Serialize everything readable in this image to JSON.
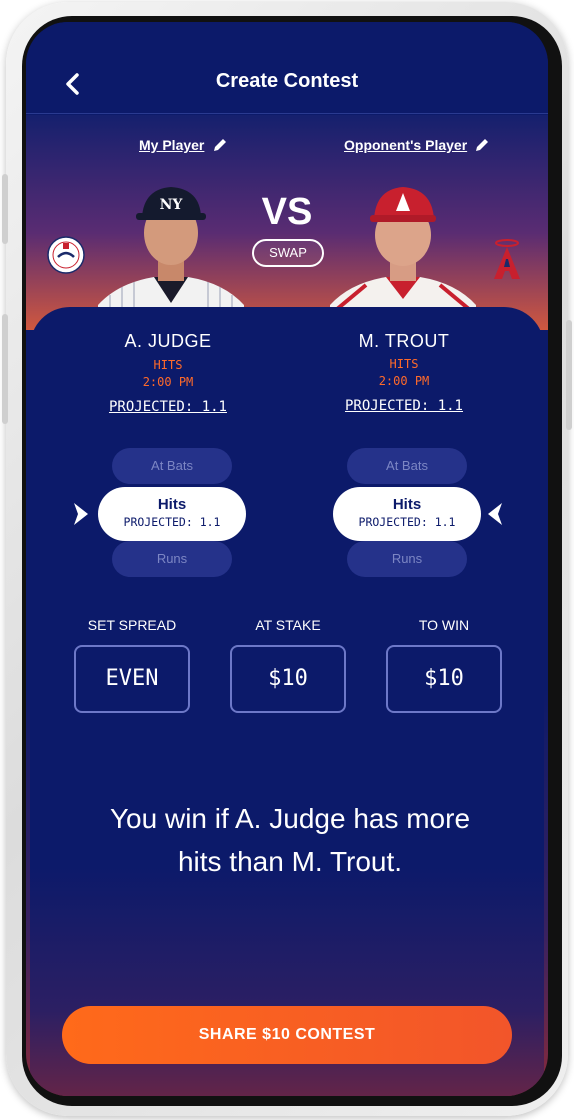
{
  "header": {
    "title": "Create Contest",
    "back_icon": "chevron-left-icon"
  },
  "hero": {
    "my_player_label": "My Player",
    "opponent_player_label": "Opponent's Player",
    "vs_label": "VS",
    "swap_label": "SWAP",
    "left_team_logo": "yankees-logo",
    "right_team_logo": "angels-logo"
  },
  "players": [
    {
      "name": "A. JUDGE",
      "stat": "HITS",
      "time": "2:00 PM",
      "projected": "PROJECTED: 1.1",
      "options": {
        "above": "At Bats",
        "selected": "Hits",
        "selected_projected": "PROJECTED: 1.1",
        "below": "Runs"
      }
    },
    {
      "name": "M. TROUT",
      "stat": "HITS",
      "time": "2:00 PM",
      "projected": "PROJECTED: 1.1",
      "options": {
        "above": "At Bats",
        "selected": "Hits",
        "selected_projected": "PROJECTED: 1.1",
        "below": "Runs"
      }
    }
  ],
  "contest": {
    "spread_label": "SET SPREAD",
    "spread_value": "EVEN",
    "stake_label": "AT STAKE",
    "stake_value": "$10",
    "win_label": "TO WIN",
    "win_value": "$10"
  },
  "summary": {
    "line1": "You win if A. Judge has more",
    "line2": "hits than M. Trout."
  },
  "share_button": "SHARE $10 CONTEST",
  "colors": {
    "navy": "#0c1a6a",
    "accent": "#ff6a2a",
    "option": "#25328a"
  }
}
